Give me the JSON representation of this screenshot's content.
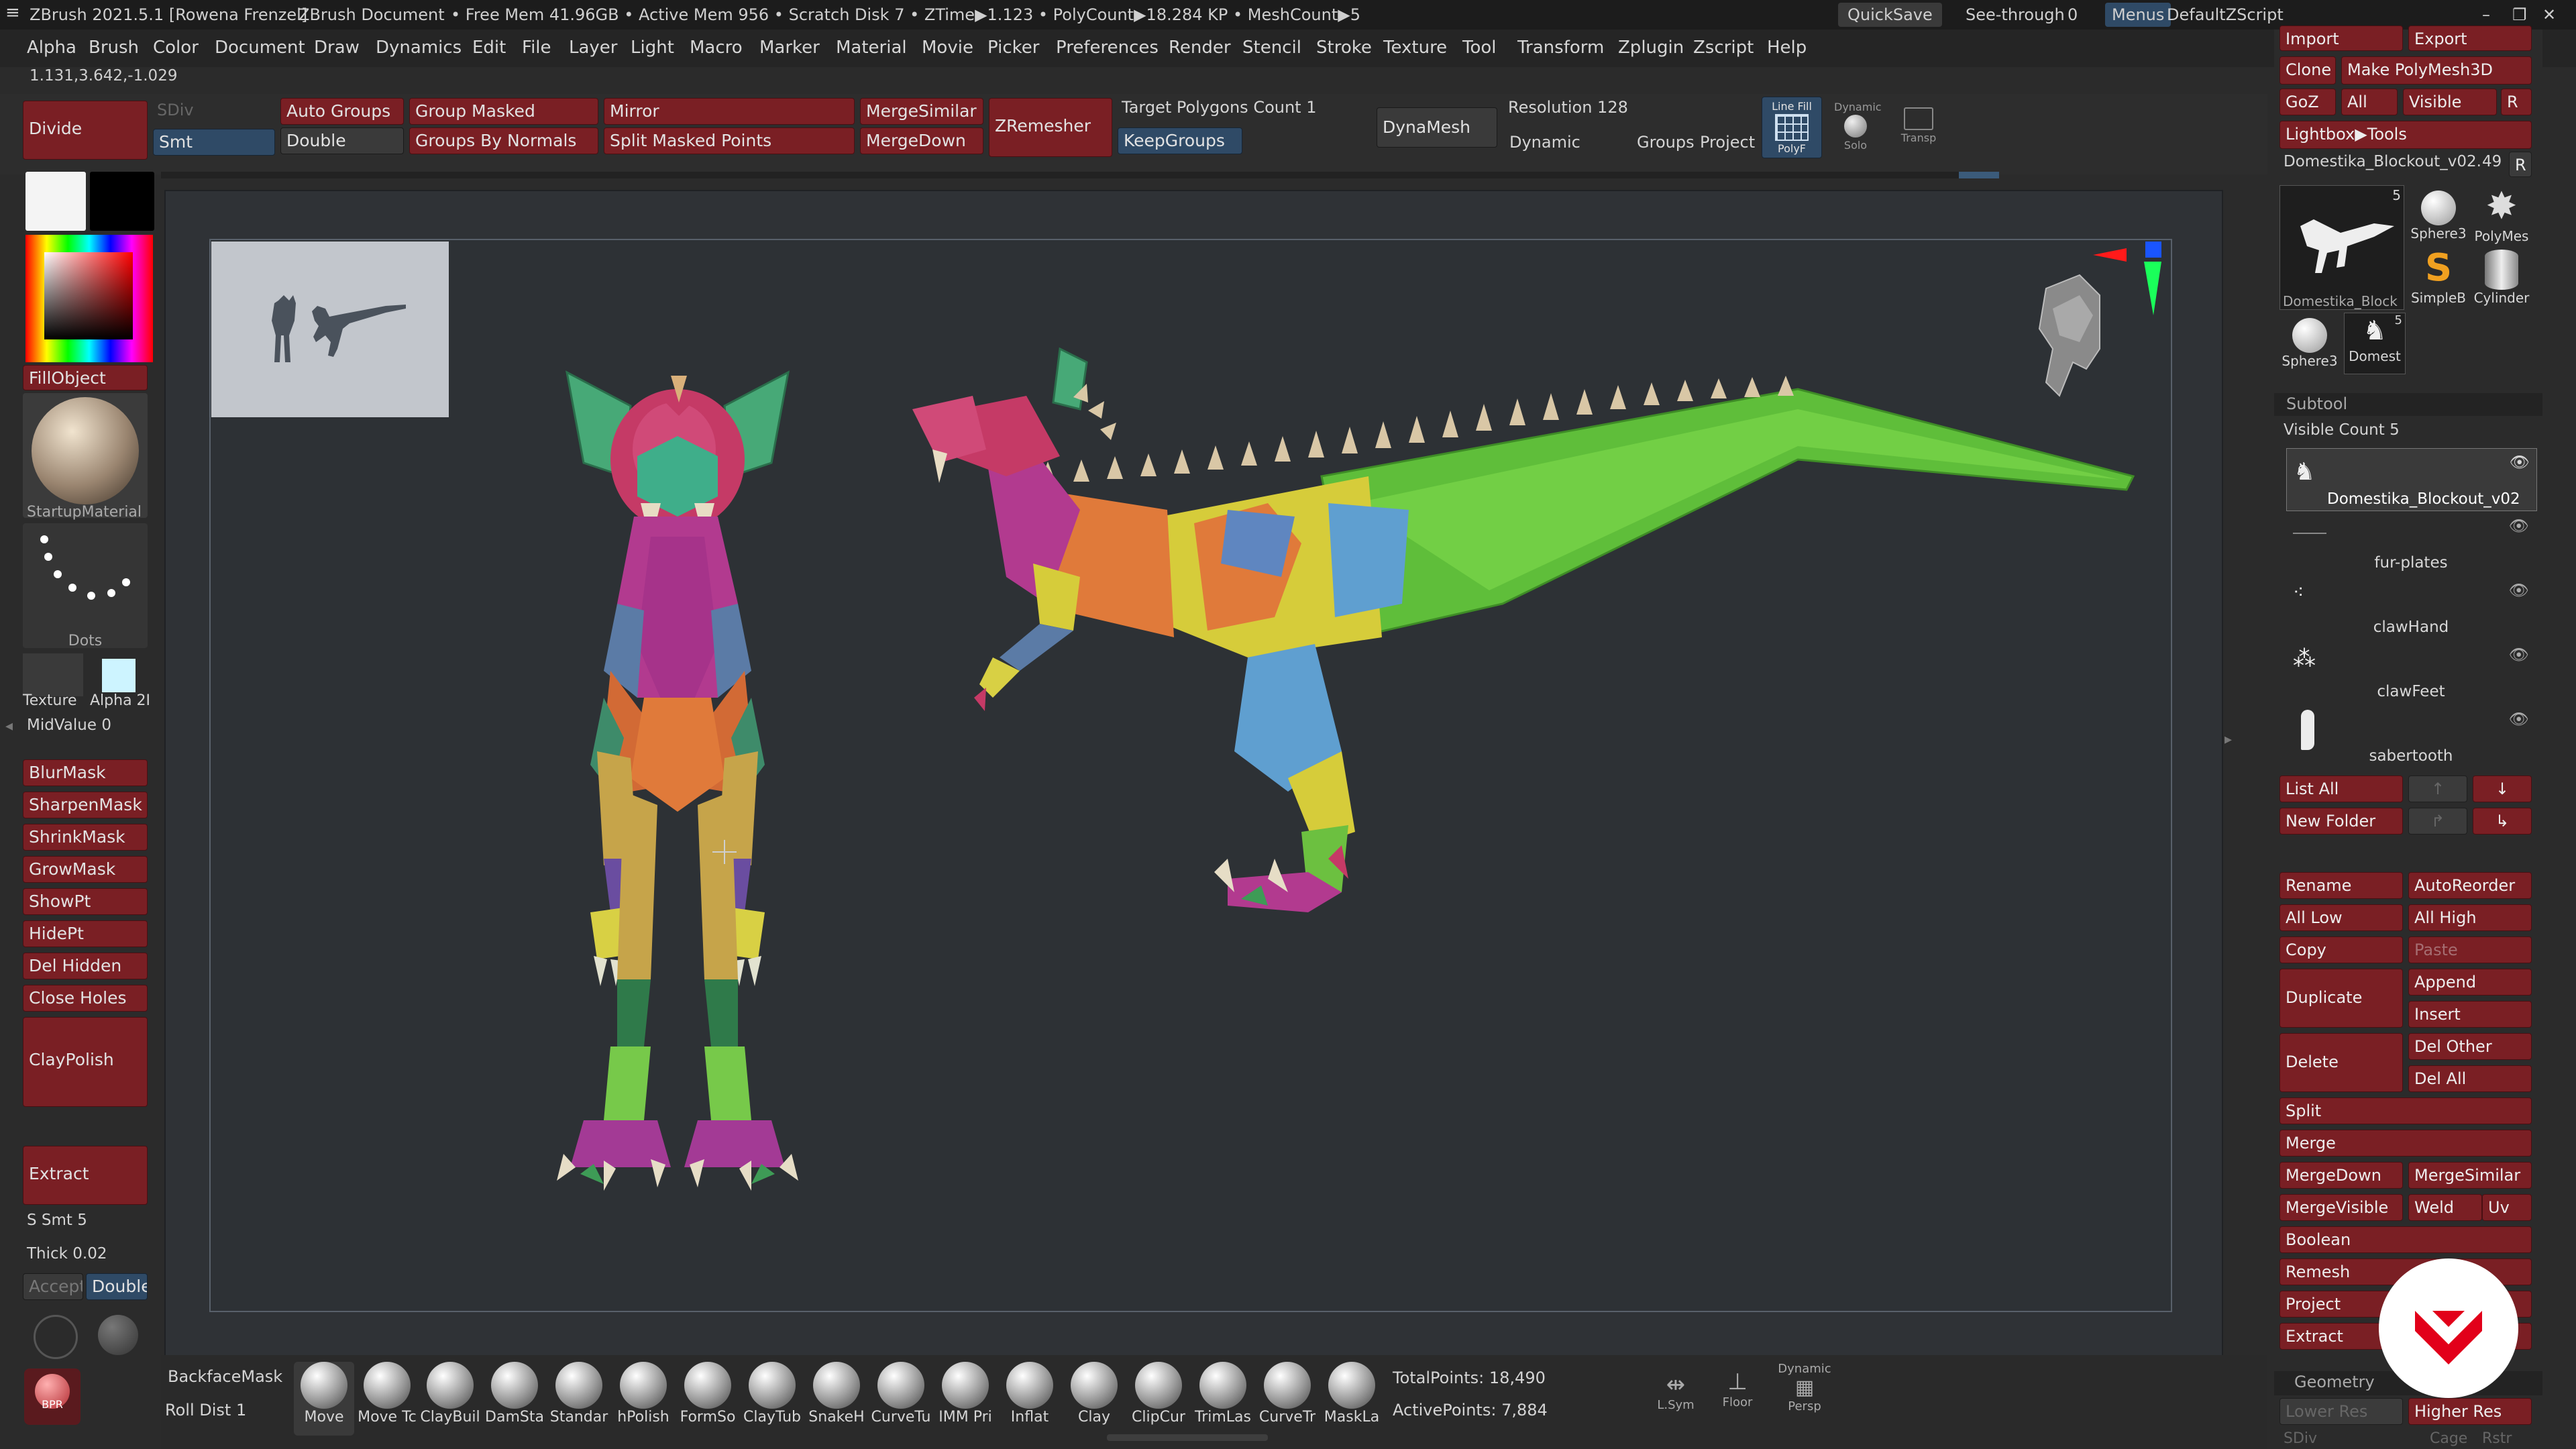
{
  "titlebar": {
    "app": "ZBrush 2021.5.1 [Rowena Frenzel]",
    "doc": "ZBrush Document",
    "status": "• Free Mem 41.96GB • Active Mem 956 • Scratch Disk 7 • ZTime▶1.123 • PolyCount▶18.284 KP • MeshCount▶5",
    "quicksave": "QuickSave",
    "seethrough_label": "See-through",
    "seethrough_value": "0",
    "menus": "Menus",
    "script": "DefaultZScript"
  },
  "menu": [
    "Alpha",
    "Brush",
    "Color",
    "Document",
    "Draw",
    "Dynamics",
    "Edit",
    "File",
    "Layer",
    "Light",
    "Macro",
    "Marker",
    "Material",
    "Movie",
    "Picker",
    "Preferences",
    "Render",
    "Stencil",
    "Stroke",
    "Texture",
    "Tool",
    "Transform",
    "Zplugin",
    "Zscript",
    "Help"
  ],
  "coords": "1.131,3.642,-1.029",
  "toolbar": {
    "divide": "Divide",
    "sdiv": "SDiv",
    "smt": "Smt",
    "auto_groups": "Auto Groups",
    "double": "Double",
    "group_masked": "Group Masked",
    "groups_by_normals": "Groups By Normals",
    "mirror": "Mirror",
    "split_masked": "Split Masked Points",
    "merge_similar": "MergeSimilar",
    "merge_down": "MergeDown",
    "zremesher": "ZRemesher",
    "target_poly_label": "Target Polygons Count",
    "target_poly_value": "1",
    "keep_groups": "KeepGroups",
    "dynamesh": "DynaMesh",
    "resolution_label": "Resolution",
    "resolution_value": "128",
    "dynamic": "Dynamic",
    "groups": "Groups",
    "project": "Project",
    "polyf": "PolyF",
    "line_fill": "Line Fill",
    "solo": "Solo",
    "dynamic_small": "Dynamic",
    "transp": "Transp"
  },
  "left": {
    "fill_object": "FillObject",
    "material": "StartupMaterial",
    "stroke": "Dots",
    "texture": "Texture",
    "alpha": "Alpha 2I",
    "midvalue_label": "MidValue",
    "midvalue_value": "0",
    "blurmask": "BlurMask",
    "sharpenmask": "SharpenMask",
    "shrinkmask": "ShrinkMask",
    "growmask": "GrowMask",
    "showpt": "ShowPt",
    "hidept": "HidePt",
    "delhidden": "Del Hidden",
    "closeholes": "Close Holes",
    "claypolish": "ClayPolish",
    "extract": "Extract",
    "ssmt_label": "S Smt",
    "ssmt_value": "5",
    "thick_label": "Thick",
    "thick_value": "0.02",
    "accept": "Accept",
    "double": "Double",
    "bpr": "BPR"
  },
  "right": {
    "import": "Import",
    "export": "Export",
    "clone": "Clone",
    "make_polymesh": "Make PolyMesh3D",
    "goz": "GoZ",
    "all": "All",
    "visible": "Visible",
    "r": "R",
    "lightbox_tools": "Lightbox▶Tools",
    "current_tool": "Domestika_Blockout_v02.",
    "current_tool_value": "49",
    "tool_thumbs": [
      {
        "label": "Domestika_Block",
        "count": "5"
      },
      {
        "label": "Sphere3",
        "count": ""
      },
      {
        "label": "PolyMes",
        "count": ""
      },
      {
        "label": "SimpleB",
        "count": ""
      },
      {
        "label": "Cylinder",
        "count": ""
      },
      {
        "label": "Sphere3",
        "count": ""
      },
      {
        "label": "Domest",
        "count": "5"
      }
    ],
    "subtool_header": "Subtool",
    "visible_count_label": "Visible Count",
    "visible_count_value": "5",
    "subtools": [
      "Domestika_Blockout_v02",
      "fur-plates",
      "clawHand",
      "clawFeet",
      "sabertooth"
    ],
    "list_all": "List All",
    "new_folder": "New Folder",
    "rename": "Rename",
    "autoreorder": "AutoReorder",
    "all_low": "All Low",
    "all_high": "All High",
    "copy": "Copy",
    "paste": "Paste",
    "duplicate": "Duplicate",
    "append": "Append",
    "insert": "Insert",
    "delete": "Delete",
    "del_other": "Del Other",
    "del_all": "Del All",
    "split": "Split",
    "merge": "Merge",
    "merge_down": "MergeDown",
    "merge_similar": "MergeSimilar",
    "merge_visible": "MergeVisible",
    "weld": "Weld",
    "uv": "Uv",
    "boolean": "Boolean",
    "remesh": "Remesh",
    "project": "Project",
    "extract": "Extract",
    "geometry": "Geometry",
    "lower_res": "Lower Res",
    "higher_res": "Higher Res",
    "sdiv": "SDiv",
    "cage": "Cage",
    "rstr": "Rstr"
  },
  "bottom": {
    "backface_mask": "BackfaceMask",
    "roll_dist_label": "Roll Dist",
    "roll_dist_value": "1",
    "brushes": [
      "Move",
      "Move Tc",
      "ClayBuil",
      "DamSta",
      "Standar",
      "hPolish",
      "FormSo",
      "ClayTub",
      "SnakeH",
      "CurveTu",
      "IMM Pri",
      "Inflat",
      "Clay",
      "ClipCur",
      "TrimLas",
      "CurveTr",
      "MaskLa"
    ],
    "total_points_label": "TotalPoints:",
    "total_points_value": "18,490",
    "active_points_label": "ActivePoints:",
    "active_points_value": "7,884",
    "lsym": "L.Sym",
    "floor": "Floor",
    "persp": "Persp",
    "dynamic": "Dynamic"
  },
  "colors": {
    "accent_red": "#7a1f24",
    "accent_blue": "#2f4a66",
    "viewport_bg": "#2d3135"
  }
}
